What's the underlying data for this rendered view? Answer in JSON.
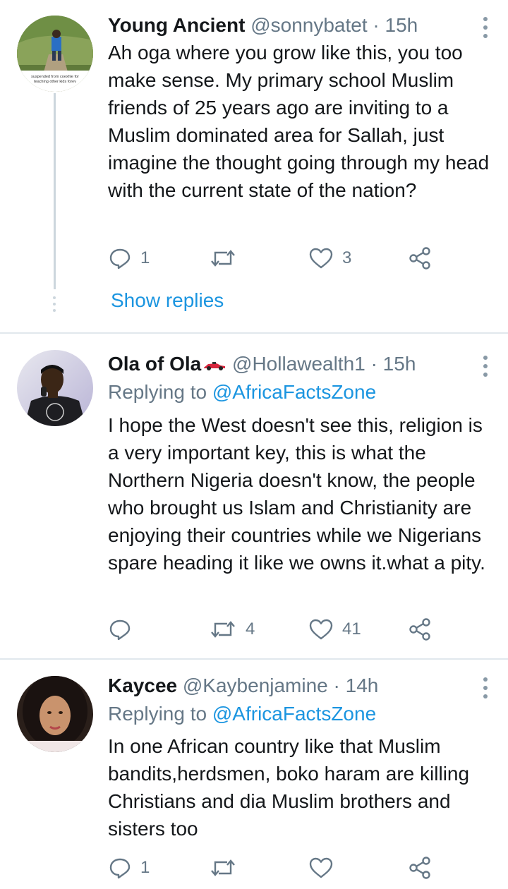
{
  "tweets": [
    {
      "name": "Young Ancient",
      "handle": "@sonnybatet",
      "time": "15h",
      "text": "Ah oga where you grow like this, you too make sense. My primary school Muslim friends of 25 years ago are inviting to a Muslim dominated area for Sallah, just imagine the thought going through my head with the current state of the nation?",
      "replies": "1",
      "retweets": "",
      "likes": "3",
      "show_replies": "Show replies",
      "avatar_caption_1": "suspended from coexhle for",
      "avatar_caption_2": "teaching other kids forev"
    },
    {
      "name": "Ola of Ola",
      "handle": "@Hollawealth1",
      "time": "15h",
      "replying_prefix": "Replying to",
      "replying_to": "@AfricaFactsZone",
      "text": "I hope the West doesn't see this, religion is a very important key, this is what the Northern Nigeria doesn't know, the people who brought us Islam and Christianity are enjoying their countries while we Nigerians spare heading it like we owns it.what a pity.",
      "replies": "",
      "retweets": "4",
      "likes": "41"
    },
    {
      "name": "Kaycee",
      "handle": "@Kaybenjamine",
      "time": "14h",
      "replying_prefix": "Replying to",
      "replying_to": "@AfricaFactsZone",
      "text": "In one African country like that Muslim bandits,herdsmen, boko haram are killing Christians and dia Muslim brothers and sisters too",
      "replies": "1",
      "retweets": "",
      "likes": ""
    }
  ],
  "separator": "·",
  "icons": [
    "reply-icon",
    "retweet-icon",
    "like-icon",
    "share-icon",
    "more-options-icon",
    "race-car-emoji-icon"
  ],
  "colors": {
    "link": "#1b95e0",
    "secondary": "#657786",
    "divider": "#e1e8ed"
  }
}
